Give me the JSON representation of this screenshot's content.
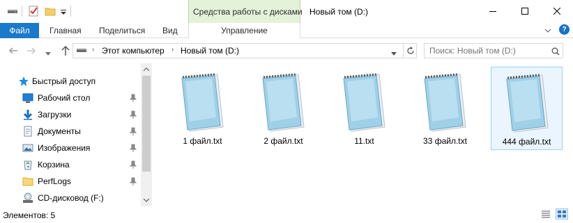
{
  "window": {
    "title": "Новый том (D:)",
    "contextual_tab_group": "Средства работы с дисками"
  },
  "ribbon": {
    "tabs": [
      {
        "label": "Файл"
      },
      {
        "label": "Главная"
      },
      {
        "label": "Поделиться"
      },
      {
        "label": "Вид"
      },
      {
        "label": "Управление"
      }
    ]
  },
  "address": {
    "crumbs": [
      "Этот компьютер",
      "Новый том (D:)"
    ]
  },
  "search": {
    "placeholder": "Поиск: Новый том (D:)"
  },
  "nav": {
    "items": [
      {
        "label": "Быстрый доступ",
        "icon": "star-icon",
        "pinned": false
      },
      {
        "label": "Рабочий стол",
        "icon": "desktop-icon",
        "pinned": true
      },
      {
        "label": "Загрузки",
        "icon": "download-icon",
        "pinned": true
      },
      {
        "label": "Документы",
        "icon": "documents-icon",
        "pinned": true
      },
      {
        "label": "Изображения",
        "icon": "pictures-icon",
        "pinned": true
      },
      {
        "label": "Корзина",
        "icon": "recycle-bin-icon",
        "pinned": true
      },
      {
        "label": "PerfLogs",
        "icon": "folder-icon",
        "pinned": true
      },
      {
        "label": "CD-дисковод (F:)",
        "icon": "cd-drive-icon",
        "pinned": false
      }
    ]
  },
  "files": [
    {
      "name": "1 файл.txt",
      "icon": "notepad-file-icon",
      "selected": false
    },
    {
      "name": "2 файл.txt",
      "icon": "notepad-file-icon",
      "selected": false
    },
    {
      "name": "11.txt",
      "icon": "notepad-file-icon",
      "selected": false
    },
    {
      "name": "33 файл.txt",
      "icon": "notepad-file-icon",
      "selected": false
    },
    {
      "name": "444 файл.txt",
      "icon": "notepad-file-icon",
      "selected": true
    }
  ],
  "status": {
    "text": "Элементов: 5"
  },
  "colors": {
    "file_tab": "#1979ca",
    "contextual_tab": "#e3f2d9",
    "selection": "#eaf5ff"
  }
}
